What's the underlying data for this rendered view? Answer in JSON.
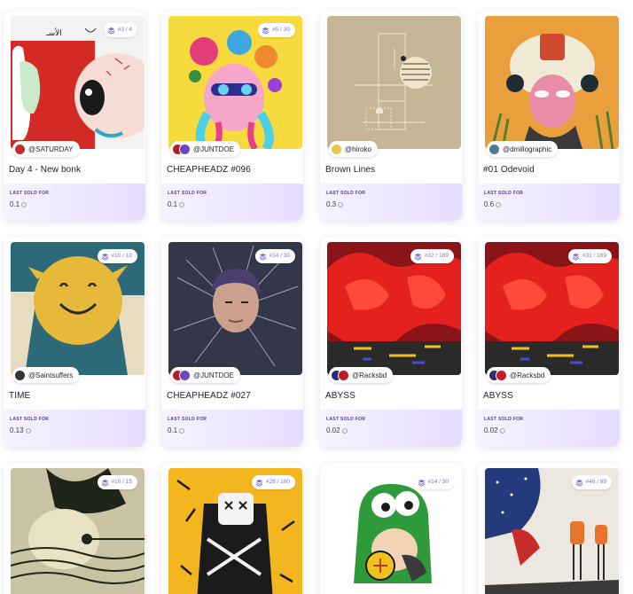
{
  "sold_label": "LAST SOLD FOR",
  "cards": [
    {
      "edition": "#3 / 4",
      "creator": "@SATURDAY",
      "title": "Day 4 - New bonk",
      "price": "0.1",
      "bg": "#f1f1f1",
      "avatars": [
        "#c62a2a"
      ]
    },
    {
      "edition": "#5 / 30",
      "creator": "@JUNTDOE",
      "title": "CHEAPHEADZ #096",
      "price": "0.1",
      "bg": "#f7da3e",
      "avatars": [
        "#b41d27",
        "#6f45c4"
      ]
    },
    {
      "edition": "",
      "creator": "@hiroko",
      "title": "Brown Lines",
      "price": "0.3",
      "bg": "#c7b695",
      "avatars": [
        "#e9c651"
      ]
    },
    {
      "edition": "",
      "creator": "@dmillographic",
      "title": "#01 Odevoid",
      "price": "0.6",
      "bg": "#e9a03c",
      "avatars": [
        "#4d7b93"
      ]
    },
    {
      "edition": "#10 / 10",
      "creator": "@Saintsuffers",
      "title": "TIME",
      "price": "0.13",
      "bg": "#2d6a79",
      "avatars": [
        "#333333"
      ]
    },
    {
      "edition": "#14 / 30",
      "creator": "@JUNTDOE",
      "title": "CHEAPHEADZ #027",
      "price": "0.1",
      "bg": "#343649",
      "avatars": [
        "#b41d27",
        "#6f45c4"
      ]
    },
    {
      "edition": "#32 / 169",
      "creator": "@Racksbd",
      "title": "ABYSS",
      "price": "0.02",
      "bg": "#8a1417",
      "avatars": [
        "#2a2e78",
        "#c21c24"
      ]
    },
    {
      "edition": "#31 / 169",
      "creator": "@Racksbd",
      "title": "ABYSS",
      "price": "0.02",
      "bg": "#8a1417",
      "avatars": [
        "#2a2e78",
        "#c21c24"
      ]
    },
    {
      "edition": "#10 / 15",
      "creator": "",
      "title": "",
      "price": "",
      "bg": "#c9c3a3",
      "avatars": []
    },
    {
      "edition": "#28 / 100",
      "creator": "",
      "title": "",
      "price": "",
      "bg": "#f3b61f",
      "avatars": []
    },
    {
      "edition": "#14 / 30",
      "creator": "",
      "title": "",
      "price": "",
      "bg": "#ffffff",
      "avatars": []
    },
    {
      "edition": "#46 / 99",
      "creator": "",
      "title": "",
      "price": "",
      "bg": "#ece8df",
      "avatars": []
    }
  ]
}
